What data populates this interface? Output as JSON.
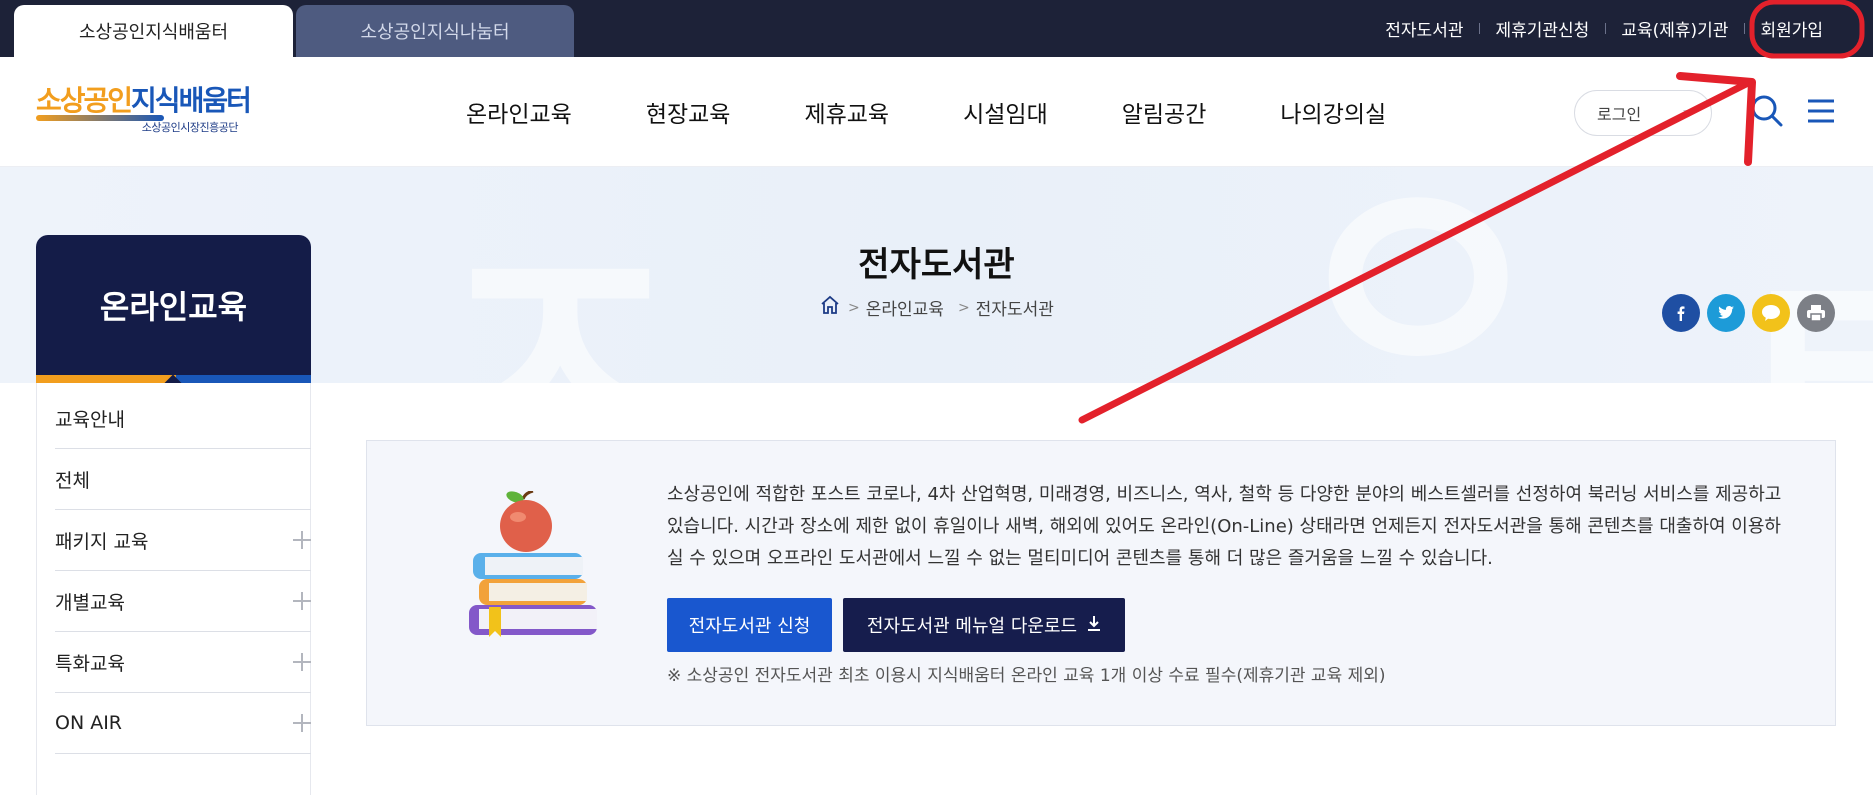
{
  "top_tabs": {
    "active": "소상공인지식배움터",
    "inactive": "소상공인지식나눔터"
  },
  "utility_links": [
    "전자도서관",
    "제휴기관신청",
    "교육(제휴)기관",
    "회원가입"
  ],
  "logo": {
    "part1": "소상공인",
    "part2": "지식배움터",
    "sub": "소상공인시장진흥공단"
  },
  "gnb": [
    "온라인교육",
    "현장교육",
    "제휴교육",
    "시설임대",
    "알림공간",
    "나의강의실"
  ],
  "login_select": "로그인",
  "icons": {
    "search": "search-icon",
    "menu": "hamburger-menu-icon",
    "home": "home-icon",
    "facebook": "facebook-icon",
    "twitter": "twitter-icon",
    "kakaotalk": "kakaotalk-icon",
    "print": "print-icon",
    "download": "download-icon"
  },
  "subvisual": {
    "title": "전자도서관",
    "breadcrumb": [
      "온라인교육",
      "전자도서관"
    ]
  },
  "lnb": {
    "title": "온라인교육",
    "items": [
      {
        "label": "교육안내",
        "expandable": false
      },
      {
        "label": "전체",
        "expandable": false
      },
      {
        "label": "패키지 교육",
        "expandable": true
      },
      {
        "label": "개별교육",
        "expandable": true
      },
      {
        "label": "특화교육",
        "expandable": true
      },
      {
        "label": "ON AIR",
        "expandable": true
      }
    ]
  },
  "content": {
    "description": "소상공인에 적합한 포스트 코로나, 4차 산업혁명, 미래경영, 비즈니스, 역사, 철학 등 다양한 분야의 베스트셀러를 선정하여 북러닝 서비스를 제공하고 있습니다. 시간과 장소에 제한 없이 휴일이나 새벽, 해외에 있어도 온라인(On-Line) 상태라면 언제든지 전자도서관을 통해 콘텐츠를 대출하여 이용하실 수 있으며 오프라인 도서관에서 느낄 수 없는 멀티미디어 콘텐츠를 통해 더 많은 즐거움을 느낄 수 있습니다.",
    "apply_button": "전자도서관 신청",
    "manual_button": "전자도서관 메뉴얼 다운로드",
    "note": "※ 소상공인 전자도서관 최초 이용시 지식배움터 온라인 교육 1개 이상 수료 필수(제휴기관 교육 제외)"
  },
  "colors": {
    "navy": "#141c48",
    "topbar": "#1d2238",
    "brand_orange": "#f29e1e",
    "brand_blue": "#1957b8",
    "annotation_red": "#e3212b"
  }
}
